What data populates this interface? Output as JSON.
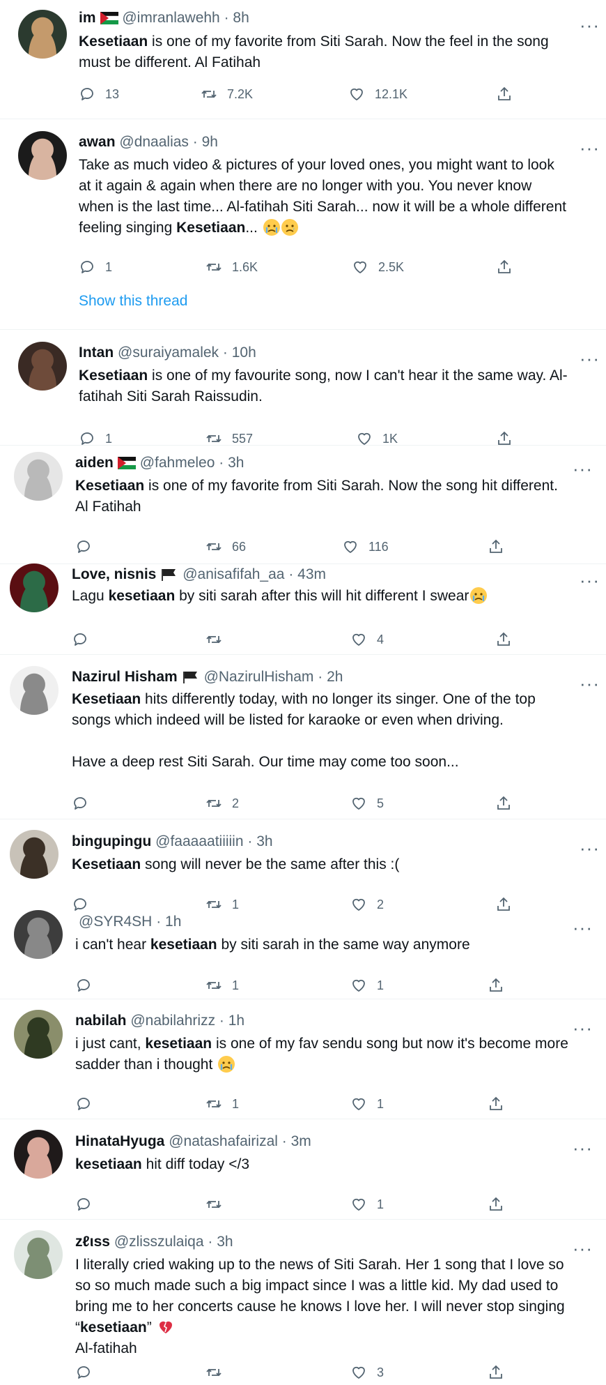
{
  "tweets": [
    {
      "name": "im",
      "flag": "jordan",
      "handle": "@imranlawehh",
      "time": "8h",
      "lines": [
        [
          [
            "b",
            "Kesetiaan"
          ],
          [
            "t",
            " is one of my favorite from Siti Sarah. Now the feel in the song"
          ]
        ],
        [
          [
            "t",
            "must be different. Al Fatihah"
          ]
        ]
      ],
      "reply": "13",
      "retweet": "7.2K",
      "like": "12.1K"
    },
    {
      "name": "awan",
      "handle": "@dnaalias",
      "time": "9h",
      "lines": [
        [
          [
            "t",
            "Take as much video & pictures of your loved ones, you might want to look"
          ]
        ],
        [
          [
            "t",
            "at it again & again when there are no longer with you. You never know"
          ]
        ],
        [
          [
            "t",
            "when is the last time... Al-fatihah Siti Sarah... now it will be a whole different"
          ]
        ],
        [
          [
            "t",
            "feeling singing "
          ],
          [
            "b",
            "Kesetiaan"
          ],
          [
            "t",
            "... "
          ]
        ]
      ],
      "emojis": [
        "crying-face",
        "sad-face"
      ],
      "reply": "1",
      "retweet": "1.6K",
      "like": "2.5K",
      "show_thread": "Show this thread"
    },
    {
      "name": "Intan",
      "handle": "@suraiyamalek",
      "time": "10h",
      "lines": [
        [
          [
            "b",
            "Kesetiaan"
          ],
          [
            "t",
            " is one of my favourite song, now I can't hear it the same way. Al-"
          ]
        ],
        [
          [
            "t",
            "fatihah Siti Sarah Raissudin."
          ]
        ]
      ],
      "reply": "1",
      "retweet": "557",
      "like": "1K"
    },
    {
      "name": "aiden",
      "flag": "palestine",
      "handle": "@fahmeleo",
      "time": "3h",
      "lines": [
        [
          [
            "b",
            "Kesetiaan"
          ],
          [
            "t",
            " is one of my favorite from Siti Sarah. Now the song hit  different."
          ]
        ],
        [
          [
            "t",
            "Al Fatihah"
          ]
        ]
      ],
      "reply": "",
      "retweet": "66",
      "like": "116"
    },
    {
      "name": "Love, nisnis",
      "flag": "black",
      "handle": "@anisafifah_aa",
      "time": "43m",
      "lines": [
        [
          [
            "t",
            "Lagu "
          ],
          [
            "b",
            "kesetiaan"
          ],
          [
            "t",
            " by siti sarah after this will hit different I swear"
          ]
        ]
      ],
      "emojis": [
        "crying-face"
      ],
      "reply": "",
      "retweet": "",
      "like": "4"
    },
    {
      "name": "Nazirul Hisham",
      "flag": "black",
      "handle": "@NazirulHisham",
      "time": "2h",
      "lines": [
        [
          [
            "b",
            "Kesetiaan"
          ],
          [
            "t",
            " hits differently today, with no longer its singer. One of the top"
          ]
        ],
        [
          [
            "t",
            "songs which indeed will be listed for karaoke or even when driving."
          ]
        ],
        [],
        [
          [
            "t",
            "Have a deep rest Siti Sarah. Our time may come too soon..."
          ]
        ]
      ],
      "reply": "",
      "retweet": "2",
      "like": "5"
    },
    {
      "name": "bingupingu",
      "handle": "@faaaaatiiiiin",
      "time": "3h",
      "lines": [
        [
          [
            "b",
            "Kesetiaan"
          ],
          [
            "t",
            " song will never be the same after this :("
          ]
        ]
      ],
      "reply": "",
      "retweet": "1",
      "like": "2"
    },
    {
      "name": "",
      "handle": "@SYR4SH",
      "time": "1h",
      "lines": [
        [
          [
            "t",
            "i can't hear "
          ],
          [
            "b",
            "kesetiaan"
          ],
          [
            "t",
            " by siti sarah in the same way anymore"
          ]
        ]
      ],
      "reply": "",
      "retweet": "1",
      "like": "1"
    },
    {
      "name": "nabilah",
      "handle": "@nabilahrizz",
      "time": "1h",
      "lines": [
        [
          [
            "t",
            "i just cant, "
          ],
          [
            "b",
            "kesetiaan"
          ],
          [
            "t",
            " is one of my fav sendu song but now it's become more"
          ]
        ],
        [
          [
            "t",
            "sadder than i thought "
          ]
        ]
      ],
      "emojis": [
        "crying-face"
      ],
      "reply": "",
      "retweet": "1",
      "like": "1"
    },
    {
      "name": "HinataHyuga",
      "handle": "@natashafairizal",
      "time": "3m",
      "lines": [
        [
          [
            "b",
            "kesetiaan"
          ],
          [
            "t",
            " hit diff today </3"
          ]
        ]
      ],
      "reply": "",
      "retweet": "",
      "like": "1"
    },
    {
      "name": "zℓιss",
      "handle": "@zlisszulaiqa",
      "time": "3h",
      "lines": [
        [
          [
            "t",
            "I literally cried waking up to the news of Siti Sarah. Her 1 song that I love so"
          ]
        ],
        [
          [
            "t",
            "so so much made such a big impact since I was a little kid. My dad used to"
          ]
        ],
        [
          [
            "t",
            "bring me to her concerts cause he knows I love her. I will never stop singing"
          ]
        ],
        [
          [
            "t",
            "“"
          ],
          [
            "b",
            "kesetiaan"
          ],
          [
            "t",
            "” "
          ]
        ],
        [
          [
            "t",
            " Al-fatihah"
          ]
        ]
      ],
      "emojis": [
        "broken-heart"
      ],
      "reply": "",
      "retweet": "",
      "like": "3"
    }
  ],
  "icons": {
    "reply": "reply-icon",
    "retweet": "retweet-icon",
    "like": "like-icon",
    "share": "share-icon",
    "more": "more-icon"
  },
  "colors": {
    "text": "#0f1419",
    "secondary": "#536471",
    "link": "#1d9bf0",
    "divider": "#eff3f4"
  }
}
